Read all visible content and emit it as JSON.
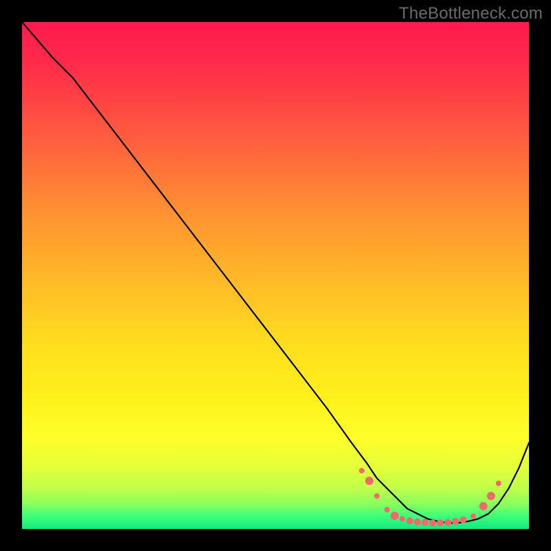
{
  "watermark": "TheBottleneck.com",
  "chart_data": {
    "type": "line",
    "title": "",
    "xlabel": "",
    "ylabel": "",
    "xlim": [
      0,
      100
    ],
    "ylim": [
      0,
      100
    ],
    "grid": false,
    "legend": false,
    "series": [
      {
        "name": "curve",
        "x": [
          0,
          6,
          10,
          20,
          30,
          40,
          50,
          60,
          65,
          68,
          70,
          72,
          74,
          76,
          78,
          80,
          82,
          84,
          86,
          88,
          90,
          92,
          94,
          96,
          98,
          100
        ],
        "y": [
          100,
          93,
          89,
          76,
          63,
          50,
          37,
          24,
          17,
          13,
          10,
          8,
          6,
          4,
          3,
          2,
          1.5,
          1.2,
          1.2,
          1.5,
          2,
          3,
          5,
          8,
          12,
          17
        ]
      }
    ],
    "markers": {
      "name": "highlighted-points",
      "color": "#ef6a6a",
      "points": [
        {
          "x": 67,
          "y": 11.5,
          "r": 4
        },
        {
          "x": 68.5,
          "y": 9.5,
          "r": 6
        },
        {
          "x": 70,
          "y": 6.5,
          "r": 4
        },
        {
          "x": 72,
          "y": 3.8,
          "r": 4
        },
        {
          "x": 73.5,
          "y": 2.6,
          "r": 6
        },
        {
          "x": 75,
          "y": 2.0,
          "r": 4
        },
        {
          "x": 76.5,
          "y": 1.6,
          "r": 5
        },
        {
          "x": 78,
          "y": 1.4,
          "r": 5
        },
        {
          "x": 79.5,
          "y": 1.3,
          "r": 5
        },
        {
          "x": 81,
          "y": 1.2,
          "r": 5
        },
        {
          "x": 82.5,
          "y": 1.2,
          "r": 5
        },
        {
          "x": 84,
          "y": 1.3,
          "r": 5
        },
        {
          "x": 85.5,
          "y": 1.5,
          "r": 5
        },
        {
          "x": 87,
          "y": 1.8,
          "r": 5
        },
        {
          "x": 89,
          "y": 2.5,
          "r": 4
        },
        {
          "x": 91,
          "y": 4.5,
          "r": 6
        },
        {
          "x": 92.5,
          "y": 6.5,
          "r": 6
        },
        {
          "x": 94,
          "y": 9.0,
          "r": 4
        }
      ]
    }
  }
}
